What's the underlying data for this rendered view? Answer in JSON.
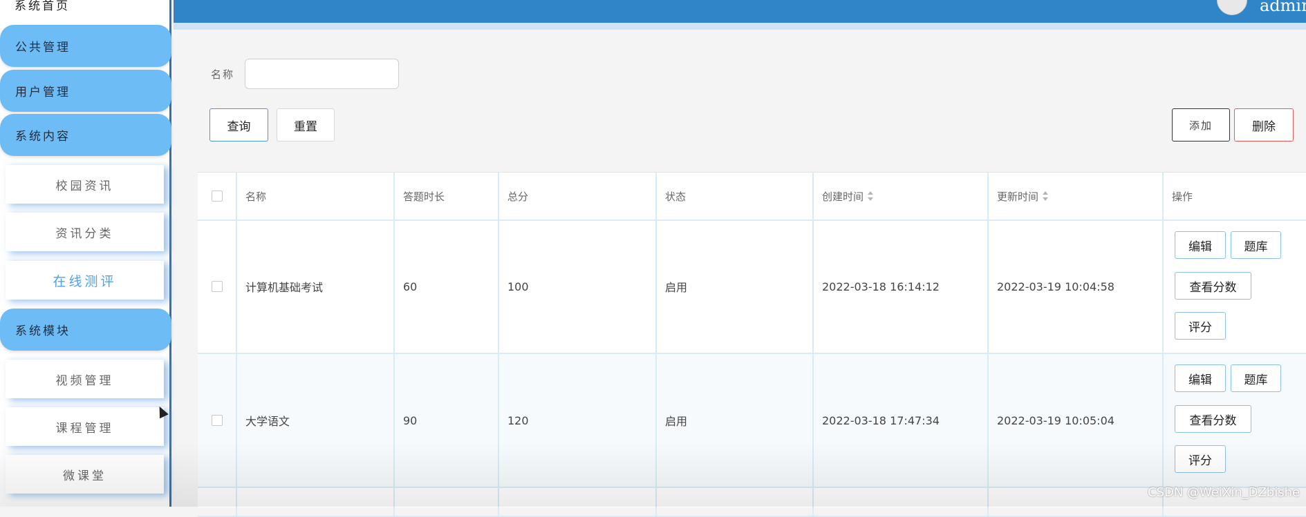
{
  "sidebar": {
    "top_item": "系统首页",
    "groups": [
      "公共管理",
      "用户管理",
      "系统内容",
      "系统模块"
    ],
    "content_items": [
      "校园资讯",
      "资讯分类",
      "在线测评"
    ],
    "module_items": [
      "视频管理",
      "课程管理",
      "微课堂"
    ],
    "active_item": "在线测评"
  },
  "topbar": {
    "username": "admin"
  },
  "search": {
    "label": "名称",
    "value": ""
  },
  "toolbar": {
    "query": "查询",
    "reset": "重置",
    "add": "添加",
    "delete": "删除"
  },
  "table": {
    "columns": [
      "名称",
      "答题时长",
      "总分",
      "状态",
      "创建时间",
      "更新时间",
      "操作"
    ],
    "rows": [
      {
        "name": "计算机基础考试",
        "duration": "60",
        "score": "100",
        "status": "启用",
        "created": "2022-03-18 16:14:12",
        "updated": "2022-03-19 10:04:58"
      },
      {
        "name": "大学语文",
        "duration": "90",
        "score": "120",
        "status": "启用",
        "created": "2022-03-18 17:47:34",
        "updated": "2022-03-19 10:05:04"
      }
    ],
    "actions": {
      "edit": "编辑",
      "bank": "题库",
      "view_score": "查看分数",
      "grade": "评分"
    }
  },
  "watermark": "CSDN @WeiXin_DZbishe"
}
